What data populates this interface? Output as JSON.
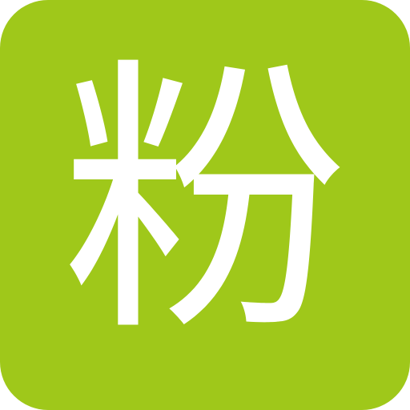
{
  "app_icon": {
    "glyph": "粉",
    "background_color": "#9fc81a",
    "glyph_color": "#ffffff"
  }
}
